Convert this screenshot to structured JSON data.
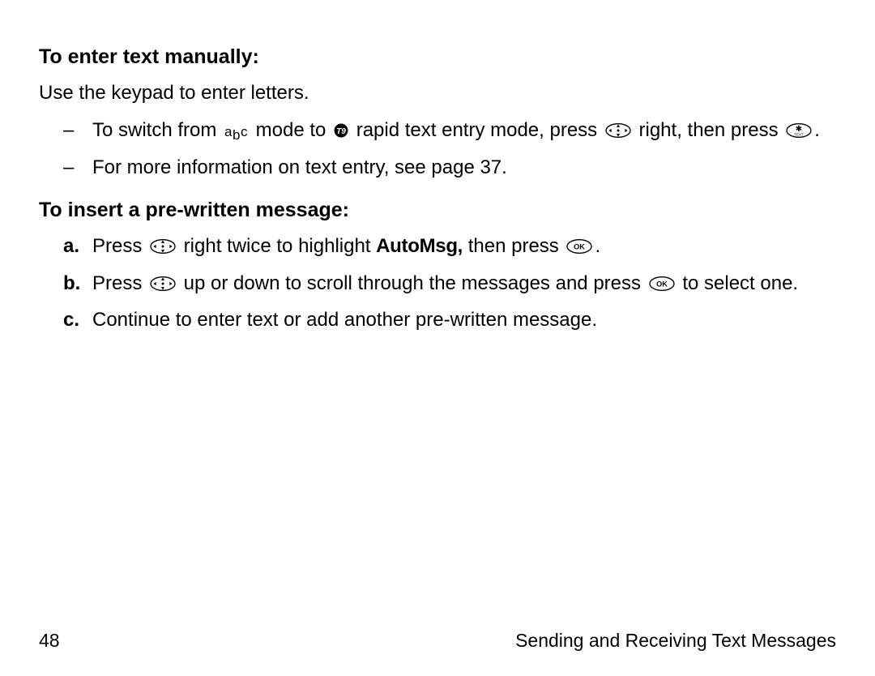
{
  "heading1": "To enter text manually:",
  "intro1": "Use the keypad to enter letters.",
  "b1": {
    "pre": "To switch from ",
    "mid1": " mode to ",
    "mid2": "rapid text entry mode, press ",
    "mid3": " right, then press ",
    "end": "."
  },
  "b2": "For more information on text entry, see page 37.",
  "heading2": "To insert a pre-written message:",
  "s": {
    "a": {
      "label": "a.",
      "t1": "Press ",
      "t2": " right twice to highlight ",
      "auto": "AutoMsg,",
      "t3": " then press ",
      "t4": "."
    },
    "b": {
      "label": "b.",
      "t1": "Press ",
      "t2": " up or down to scroll through the messages and press ",
      "t3": " to select one."
    },
    "c": {
      "label": "c.",
      "t": "Continue to enter text or add another pre-written message."
    }
  },
  "footer": {
    "page": "48",
    "section": "Sending and Receiving Text Messages"
  },
  "dash": "–"
}
